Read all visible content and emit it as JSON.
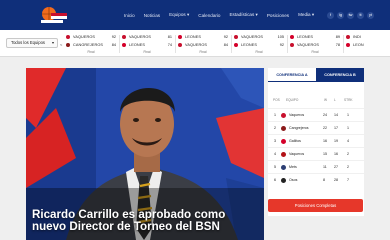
{
  "nav": {
    "logo_alt": "Liga de Baloncesto",
    "items": [
      {
        "label": "Inicio"
      },
      {
        "label": "Noticias"
      },
      {
        "label": "Equipos ▾"
      },
      {
        "label": "Calendario"
      },
      {
        "label": "Estadísticas ▾"
      },
      {
        "label": "Posiciones"
      },
      {
        "label": "Media ▾"
      }
    ],
    "social": [
      "f",
      "ig",
      "tw",
      "tt",
      "yt"
    ]
  },
  "scores": {
    "filter_label": "Todos los Equipos",
    "filter_suffix": "<",
    "games": [
      {
        "team1": "VAQUEROS",
        "score1": "92",
        "team2": "CANGREJEROS",
        "score2": "84",
        "status": "Final"
      },
      {
        "team1": "VAQUEROS",
        "score1": "81",
        "team2": "LEONES",
        "score2": "74",
        "status": "Final"
      },
      {
        "team1": "LEONES",
        "score1": "92",
        "team2": "VAQUEROS",
        "score2": "84",
        "status": "Final"
      },
      {
        "team1": "VAQUEROS",
        "score1": "105",
        "team2": "LEONES",
        "score2": "92",
        "status": "Final"
      },
      {
        "team1": "LEONES",
        "score1": "89",
        "team2": "VAQUEROS",
        "score2": "78",
        "status": "Final"
      },
      {
        "team1": "INDI",
        "score1": "",
        "team2": "LEON",
        "score2": "",
        "status": ""
      }
    ]
  },
  "hero": {
    "headline": "Ricardo Carrillo es aprobado como nuevo Director de Torneo del BSN"
  },
  "standings": {
    "tabs": [
      "CONFERENCIA A",
      "CONFERENCIA B"
    ],
    "headers": {
      "pos": "POS",
      "team": "EQUIPO",
      "w": "W",
      "l": "L",
      "streak": "STRK"
    },
    "rows": [
      {
        "pos": "1",
        "team": "Vaqueros",
        "w": "24",
        "l": "14",
        "streak": "1",
        "color": "#c8102e"
      },
      {
        "pos": "2",
        "team": "Cangrejeros",
        "w": "22",
        "l": "17",
        "streak": "1",
        "color": "#8b1a1a"
      },
      {
        "pos": "3",
        "team": "Gallitos",
        "w": "16",
        "l": "19",
        "streak": "4",
        "color": "#d4002a"
      },
      {
        "pos": "4",
        "team": "Vaqueros",
        "w": "15",
        "l": "16",
        "streak": "2",
        "color": "#b31217"
      },
      {
        "pos": "5",
        "team": "Mets",
        "w": "11",
        "l": "27",
        "streak": "2",
        "color": "#2c3e73"
      },
      {
        "pos": "6",
        "team": "Osos",
        "w": "8",
        "l": "28",
        "streak": "7",
        "color": "#222222"
      }
    ],
    "cta": "Posiciones Completas"
  },
  "colors": {
    "brand": "#0f2f7a",
    "accent": "#e6372a"
  }
}
